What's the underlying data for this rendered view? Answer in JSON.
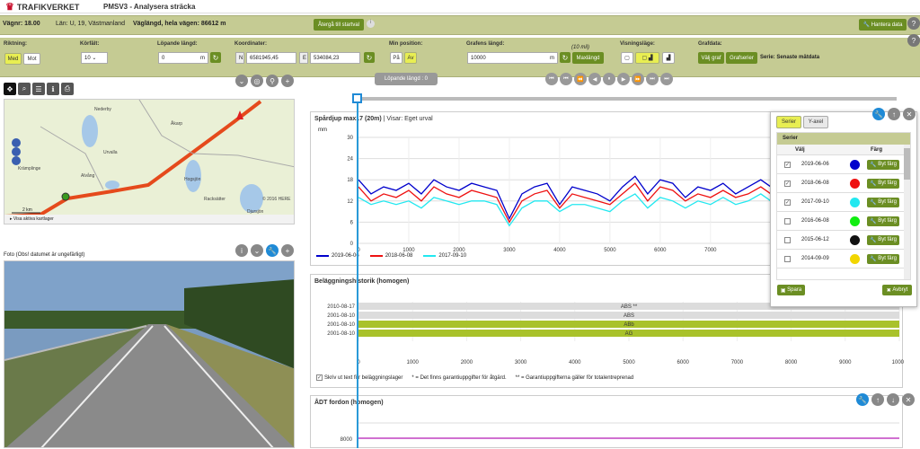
{
  "app": {
    "logo": "TRAFIKVERKET",
    "title": "PMSV3 - Analysera sträcka"
  },
  "info": {
    "road": "Vägnr: 18.00",
    "county": "Län: U, 19, Västmanland",
    "length": "Väglängd, hela vägen:  86612 m",
    "back_button": "Återgå till startval",
    "manage_data": "Hantera data"
  },
  "controls": {
    "direction": {
      "label": "Riktning:",
      "options": [
        "Med",
        "Mot"
      ],
      "selected": "Med"
    },
    "lane": {
      "label": "Körfält:",
      "value": "10"
    },
    "running_length": {
      "label": "Löpande längd:",
      "value": "0",
      "unit": "m"
    },
    "coords": {
      "label": "Koordinater:",
      "n_prefix": "N",
      "n_value": "6581945,45",
      "e_prefix": "E",
      "e_value": "534084,23"
    },
    "min_pos": {
      "label": "Min position:",
      "options": [
        "På",
        "Av"
      ],
      "selected": "Av"
    },
    "graph_length": {
      "label": "Grafens längd:",
      "value": "10000",
      "unit": "m",
      "hint": "(10 mil)",
      "max_button": "Maxlängd"
    },
    "view_mode": {
      "label": "Visningsläge:"
    },
    "graph_data": {
      "label": "Grafdata:",
      "choose_graph": "Välj graf",
      "graph_series": "Grafserier",
      "series_text": "Serie: Senaste mätdata"
    }
  },
  "map": {
    "places": [
      "Nederby",
      "Åkarp",
      "Urvalla",
      "Krämplinge",
      "Alvång",
      "Hogsjön",
      "Racksätter",
      "Djursjön"
    ],
    "scale": "2 km",
    "copyright": "© 2016 HERE",
    "toggle": "Visa aktiva kartlager"
  },
  "photo": {
    "title": "Foto (Obs! datumet är ungefärligt)"
  },
  "running_badge": "Löpande längd : 0",
  "rut_chart": {
    "title": "Spårdjup max17 (20m)",
    "view": "| Visar: Eget urval",
    "unit": "mm"
  },
  "history": {
    "title": "Beläggningshistorik (homogen)",
    "footer_check": "Skriv ut text för beläggningslager",
    "note1": "* = Det finns garantiuppgifter för åtgärd.",
    "note2": "** = Garantiuppgifterna gäller för totalentreprenad"
  },
  "adt": {
    "title": "ÅDT fordon (homogen)",
    "ytick": "8000"
  },
  "series_panel": {
    "tabs": [
      "Serier",
      "Y-axel"
    ],
    "header": "Serier",
    "col_select": "Välj",
    "col_color": "Färg",
    "rows": [
      {
        "date": "2019-06-06",
        "checked": true,
        "color": "#0000cc",
        "btn": "Byt färg"
      },
      {
        "date": "2018-06-08",
        "checked": true,
        "color": "#ee1111",
        "btn": "Byt färg"
      },
      {
        "date": "2017-09-10",
        "checked": true,
        "color": "#22e8f0",
        "btn": "Byt färg"
      },
      {
        "date": "2016-06-08",
        "checked": false,
        "color": "#11ee11",
        "btn": "Byt färg"
      },
      {
        "date": "2015-06-12",
        "checked": false,
        "color": "#111111",
        "btn": "Byt färg"
      },
      {
        "date": "2014-09-09",
        "checked": false,
        "color": "#f2d600",
        "btn": "Byt färg"
      }
    ],
    "save": "Spara",
    "cancel": "Avbryt"
  },
  "chart_data": [
    {
      "type": "line",
      "title": "Spårdjup max17 (20m)",
      "ylabel": "mm",
      "xlim": [
        0,
        8200
      ],
      "ylim": [
        0,
        30
      ],
      "yticks": [
        0,
        6,
        12,
        18,
        24,
        30
      ],
      "xticks": [
        0,
        1000,
        2000,
        3000,
        4000,
        5000,
        6000,
        7000
      ],
      "x": [
        0,
        250,
        500,
        750,
        1000,
        1250,
        1500,
        1750,
        2000,
        2250,
        2500,
        2750,
        3000,
        3250,
        3500,
        3750,
        4000,
        4250,
        4500,
        4750,
        5000,
        5250,
        5500,
        5750,
        6000,
        6250,
        6500,
        6750,
        7000,
        7250,
        7500,
        7750,
        8000,
        8200
      ],
      "series": [
        {
          "name": "2019-06-06",
          "color": "#0000cc",
          "values": [
            18,
            14,
            16,
            15,
            17,
            14,
            18,
            16,
            15,
            17,
            16,
            15,
            7,
            14,
            16,
            17,
            11,
            16,
            15,
            14,
            12,
            16,
            19,
            14,
            18,
            17,
            13,
            16,
            15,
            17,
            14,
            16,
            18,
            16
          ]
        },
        {
          "name": "2018-06-08",
          "color": "#ee1111",
          "values": [
            16,
            12,
            14,
            13,
            15,
            12,
            16,
            14,
            13,
            15,
            14,
            13,
            6,
            12,
            14,
            15,
            10,
            14,
            13,
            12,
            11,
            14,
            17,
            12,
            16,
            15,
            12,
            14,
            13,
            15,
            13,
            14,
            16,
            14
          ]
        },
        {
          "name": "2017-09-10",
          "color": "#22e8f0",
          "values": [
            13,
            11,
            12,
            11,
            12,
            10,
            13,
            12,
            11,
            12,
            12,
            11,
            5,
            10,
            12,
            12,
            9,
            11,
            11,
            10,
            9,
            12,
            14,
            10,
            13,
            12,
            10,
            12,
            11,
            13,
            11,
            12,
            14,
            12
          ]
        }
      ]
    },
    {
      "type": "bar",
      "title": "Beläggningshistorik (homogen)",
      "categories": [
        "2010-08-17",
        "2001-08-10",
        "2001-08-10",
        "2001-08-10"
      ],
      "labels": [
        "ABS **",
        "ABS",
        "ABb",
        "AG"
      ],
      "colors": [
        "#dcdcdc",
        "#dcdcdc",
        "#a9c22b",
        "#a9c22b"
      ],
      "xlim": [
        0,
        10000
      ],
      "xticks": [
        0,
        1000,
        2000,
        3000,
        4000,
        5000,
        6000,
        7000,
        8000,
        9000,
        10000
      ]
    }
  ]
}
